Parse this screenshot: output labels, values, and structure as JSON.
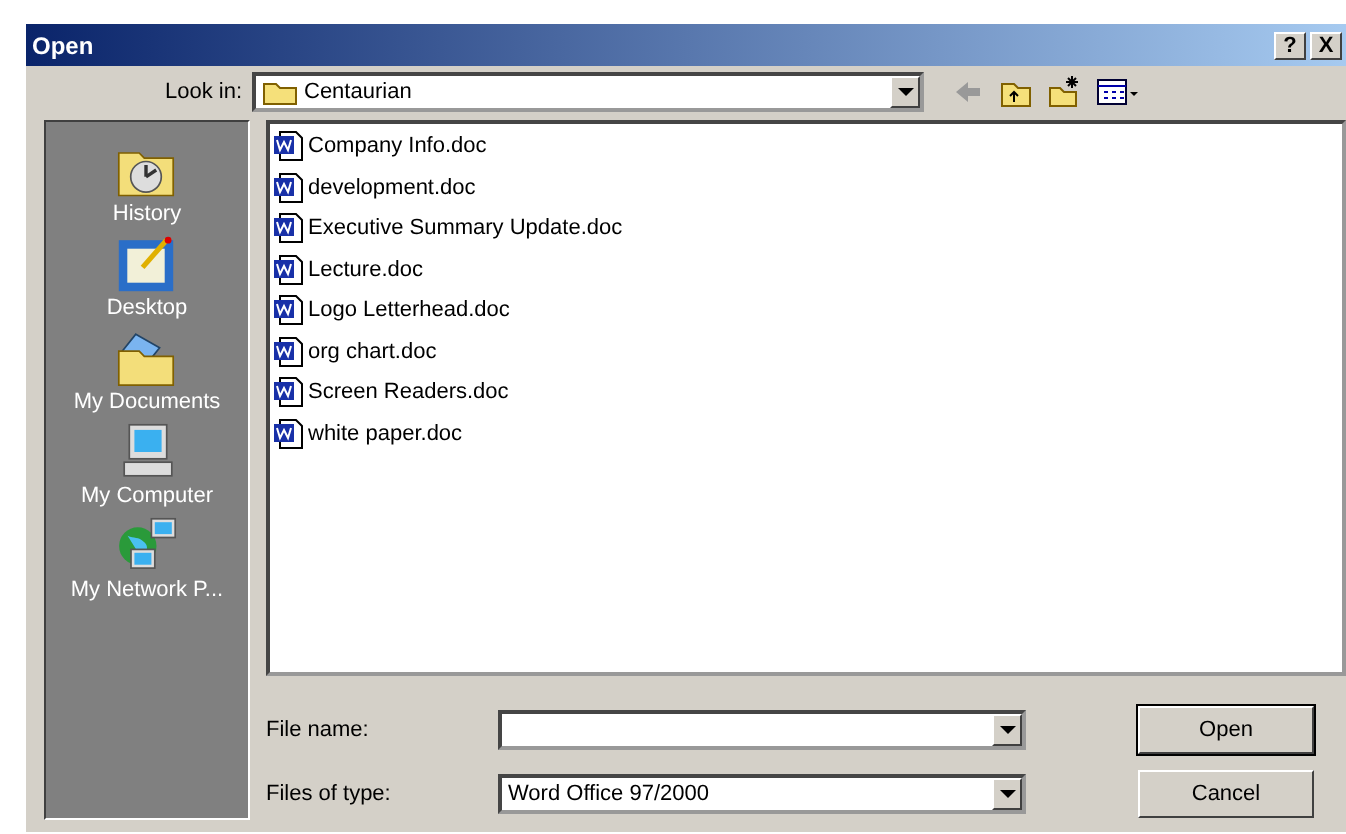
{
  "window": {
    "title": "Open",
    "help_button": "?",
    "close_button": "X"
  },
  "look_in": {
    "label": "Look in:",
    "value": "Centaurian"
  },
  "places": [
    {
      "kind": "history",
      "label": "History"
    },
    {
      "kind": "desktop",
      "label": "Desktop"
    },
    {
      "kind": "documents",
      "label": "My Documents"
    },
    {
      "kind": "computer",
      "label": "My Computer"
    },
    {
      "kind": "network",
      "label": "My Network P..."
    }
  ],
  "files": [
    "Company Info.doc",
    "development.doc",
    "Executive Summary Update.doc",
    "Lecture.doc",
    "Logo Letterhead.doc",
    "org chart.doc",
    "Screen Readers.doc",
    "white paper.doc"
  ],
  "file_name": {
    "label": "File name:"
  },
  "file_type": {
    "label": "Files of type:",
    "value": "Word Office 97/2000"
  },
  "buttons": [
    "Open",
    "Cancel"
  ]
}
